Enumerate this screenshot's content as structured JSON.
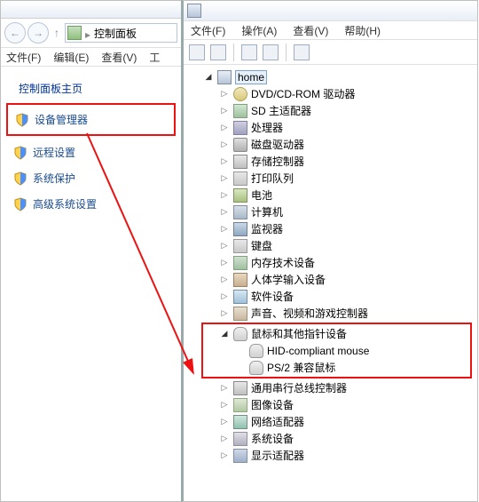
{
  "left": {
    "addr_text": "控制面板",
    "menu": {
      "file": "文件(F)",
      "edit": "编辑(E)",
      "view": "查看(V)",
      "tools": "工"
    },
    "cp_title": "控制面板主页",
    "items": [
      {
        "label": "设备管理器",
        "name": "device-manager",
        "highlight": true
      },
      {
        "label": "远程设置",
        "name": "remote-settings",
        "highlight": false
      },
      {
        "label": "系统保护",
        "name": "system-protection",
        "highlight": false
      },
      {
        "label": "高级系统设置",
        "name": "advanced-system-settings",
        "highlight": false
      }
    ]
  },
  "right": {
    "menu": {
      "file": "文件(F)",
      "action": "操作(A)",
      "view": "查看(V)",
      "help": "帮助(H)"
    },
    "root": "home",
    "categories": [
      {
        "label": "DVD/CD-ROM 驱动器",
        "icon": "dev-cd"
      },
      {
        "label": "SD 主适配器",
        "icon": "dev-card"
      },
      {
        "label": "处理器",
        "icon": "dev-cpu"
      },
      {
        "label": "磁盘驱动器",
        "icon": "dev-disk"
      },
      {
        "label": "存储控制器",
        "icon": "dev-usb"
      },
      {
        "label": "打印队列",
        "icon": "dev-print"
      },
      {
        "label": "电池",
        "icon": "dev-bat"
      },
      {
        "label": "计算机",
        "icon": "dev-pc"
      },
      {
        "label": "监视器",
        "icon": "dev-mon"
      },
      {
        "label": "键盘",
        "icon": "dev-kb"
      },
      {
        "label": "内存技术设备",
        "icon": "dev-chip"
      },
      {
        "label": "人体学输入设备",
        "icon": "dev-hid"
      },
      {
        "label": "软件设备",
        "icon": "dev-sw"
      },
      {
        "label": "声音、视频和游戏控制器",
        "icon": "dev-snd"
      }
    ],
    "mouse_group": {
      "label": "鼠标和其他指针设备",
      "children": [
        {
          "label": "HID-compliant mouse"
        },
        {
          "label": "PS/2 兼容鼠标"
        }
      ]
    },
    "categories_after": [
      {
        "label": "通用串行总线控制器",
        "icon": "dev-usb"
      },
      {
        "label": "图像设备",
        "icon": "dev-img"
      },
      {
        "label": "网络适配器",
        "icon": "dev-net"
      },
      {
        "label": "系统设备",
        "icon": "dev-sys"
      },
      {
        "label": "显示适配器",
        "icon": "dev-disp"
      }
    ]
  }
}
